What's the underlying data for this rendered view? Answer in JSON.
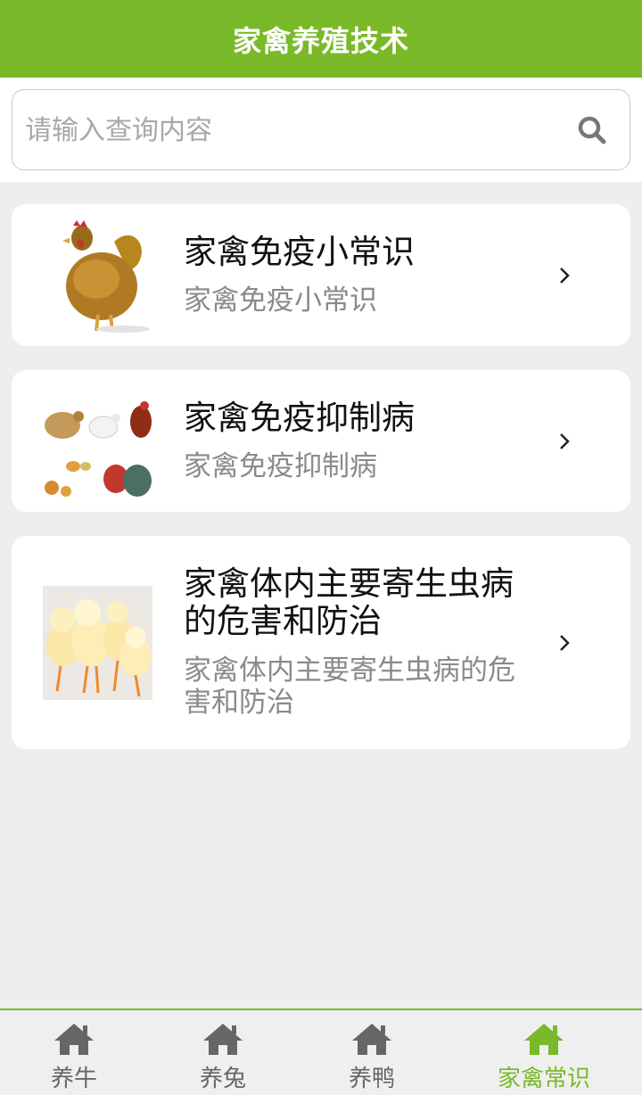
{
  "header": {
    "title": "家禽养殖技术"
  },
  "search": {
    "placeholder": "请输入查询内容",
    "icon": "search-icon"
  },
  "articles": [
    {
      "title": "家禽免疫小常识",
      "subtitle": "家禽免疫小常识"
    },
    {
      "title": "家禽免疫抑制病",
      "subtitle": "家禽免疫抑制病"
    },
    {
      "title": "家禽体内主要寄生虫病的危害和防治",
      "subtitle": "家禽体内主要寄生虫病的危害和防治"
    }
  ],
  "tabs": [
    {
      "label": "养牛",
      "icon": "home-icon",
      "active": false
    },
    {
      "label": "养兔",
      "icon": "home-icon",
      "active": false
    },
    {
      "label": "养鸭",
      "icon": "home-icon",
      "active": false
    },
    {
      "label": "家禽常识",
      "icon": "home-icon",
      "active": true
    }
  ],
  "colors": {
    "accent": "#7ab929",
    "inactive": "#666666",
    "background": "#eeeeee"
  }
}
